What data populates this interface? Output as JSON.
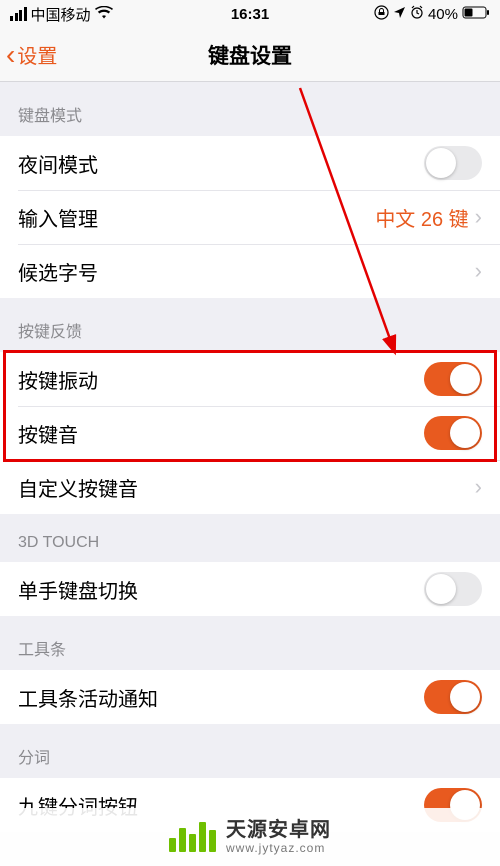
{
  "status": {
    "carrier": "中国移动",
    "time": "16:31",
    "battery": "40%"
  },
  "nav": {
    "back": "设置",
    "title": "键盘设置"
  },
  "sections": {
    "mode": {
      "header": "键盘模式",
      "night": "夜间模式",
      "input_mgmt": "输入管理",
      "input_value": "中文 26 键",
      "candidate": "候选字号"
    },
    "feedback": {
      "header": "按键反馈",
      "vibrate": "按键振动",
      "sound": "按键音",
      "custom_sound": "自定义按键音"
    },
    "touch3d": {
      "header": "3D TOUCH",
      "onehand": "单手键盘切换"
    },
    "toolbar": {
      "header": "工具条",
      "activity": "工具条活动通知"
    },
    "segment": {
      "header": "分词",
      "ninekey": "九键分词按钮"
    }
  },
  "watermark": {
    "main": "天源安卓网",
    "sub": "www.jytyaz.com"
  }
}
